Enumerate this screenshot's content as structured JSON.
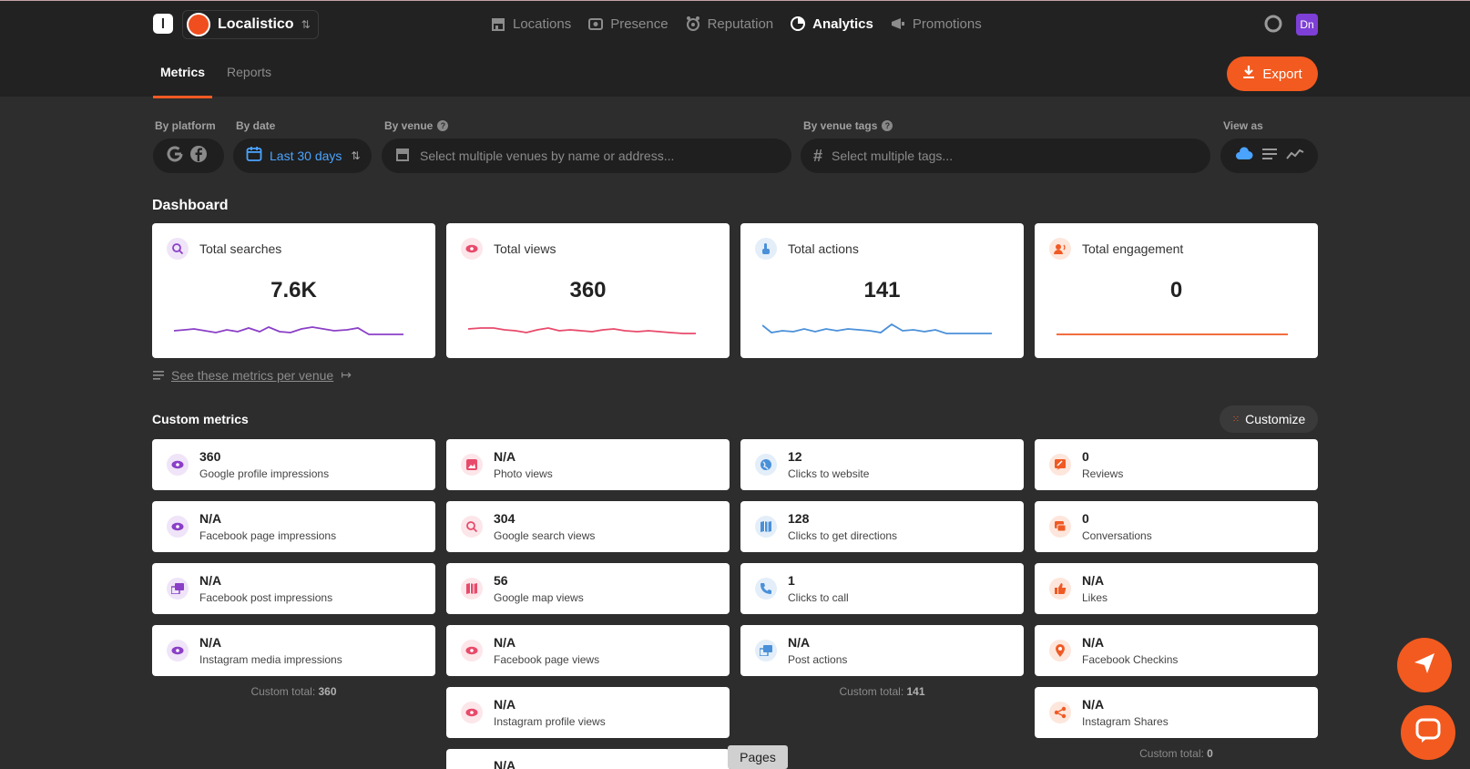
{
  "header": {
    "logo_letter": "l",
    "brand_name": "Localistico",
    "nav": [
      {
        "label": "Locations",
        "icon": "store-icon",
        "active": false
      },
      {
        "label": "Presence",
        "icon": "presence-icon",
        "active": false
      },
      {
        "label": "Reputation",
        "icon": "reputation-icon",
        "active": false
      },
      {
        "label": "Analytics",
        "icon": "analytics-icon",
        "active": true
      },
      {
        "label": "Promotions",
        "icon": "megaphone-icon",
        "active": false
      }
    ],
    "user_initials": "Dn"
  },
  "tabs": [
    {
      "label": "Metrics",
      "active": true
    },
    {
      "label": "Reports",
      "active": false
    }
  ],
  "export_label": "Export",
  "filters": {
    "platform_label": "By platform",
    "date_label": "By date",
    "date_value": "Last 30 days",
    "venue_label": "By venue",
    "venue_placeholder": "Select multiple venues by name or address...",
    "tags_label": "By venue tags",
    "tags_placeholder": "Select multiple tags...",
    "view_label": "View as"
  },
  "dashboard": {
    "title": "Dashboard",
    "cards": [
      {
        "label": "Total searches",
        "value": "7.6K",
        "color": "#8b3fc7",
        "icon": "search-icon"
      },
      {
        "label": "Total views",
        "value": "360",
        "color": "#e84a6b",
        "icon": "eye-icon"
      },
      {
        "label": "Total actions",
        "value": "141",
        "color": "#4a90d9",
        "icon": "pointer-icon"
      },
      {
        "label": "Total engagement",
        "value": "0",
        "color": "#f05a24",
        "icon": "engagement-icon"
      }
    ],
    "see_link": "See these metrics per venue"
  },
  "custom": {
    "title": "Custom metrics",
    "customize_label": "Customize",
    "col1": [
      {
        "value": "360",
        "label": "Google profile impressions",
        "icon": "eye-icon"
      },
      {
        "value": "N/A",
        "label": "Facebook page impressions",
        "icon": "eye-icon"
      },
      {
        "value": "N/A",
        "label": "Facebook post impressions",
        "icon": "posts-icon"
      },
      {
        "value": "N/A",
        "label": "Instagram media impressions",
        "icon": "eye-icon"
      }
    ],
    "col1_total_label": "Custom total:",
    "col1_total": "360",
    "col2": [
      {
        "value": "N/A",
        "label": "Photo views",
        "icon": "photo-icon"
      },
      {
        "value": "304",
        "label": "Google search views",
        "icon": "search-icon"
      },
      {
        "value": "56",
        "label": "Google map views",
        "icon": "map-icon"
      },
      {
        "value": "N/A",
        "label": "Facebook page views",
        "icon": "eye-icon"
      },
      {
        "value": "N/A",
        "label": "Instagram profile views",
        "icon": "eye-icon"
      },
      {
        "value": "N/A",
        "label": "",
        "icon": "eye-icon"
      }
    ],
    "col3": [
      {
        "value": "12",
        "label": "Clicks to website",
        "icon": "globe-icon"
      },
      {
        "value": "128",
        "label": "Clicks to get directions",
        "icon": "map-icon"
      },
      {
        "value": "1",
        "label": "Clicks to call",
        "icon": "phone-icon"
      },
      {
        "value": "N/A",
        "label": "Post actions",
        "icon": "posts-icon"
      }
    ],
    "col3_total_label": "Custom total:",
    "col3_total": "141",
    "col4": [
      {
        "value": "0",
        "label": "Reviews",
        "icon": "review-icon"
      },
      {
        "value": "0",
        "label": "Conversations",
        "icon": "chat-icon"
      },
      {
        "value": "N/A",
        "label": "Likes",
        "icon": "thumbs-up-icon"
      },
      {
        "value": "N/A",
        "label": "Facebook Checkins",
        "icon": "pin-icon"
      },
      {
        "value": "N/A",
        "label": "Instagram Shares",
        "icon": "share-icon"
      }
    ],
    "col4_total_label": "Custom total:",
    "col4_total": "0"
  },
  "pages_tooltip": "Pages",
  "colors": {
    "accent": "#f35a1f",
    "purple": "#8b3fc7",
    "pink": "#e84a6b",
    "blue": "#4a90d9",
    "orange": "#f05a24"
  }
}
